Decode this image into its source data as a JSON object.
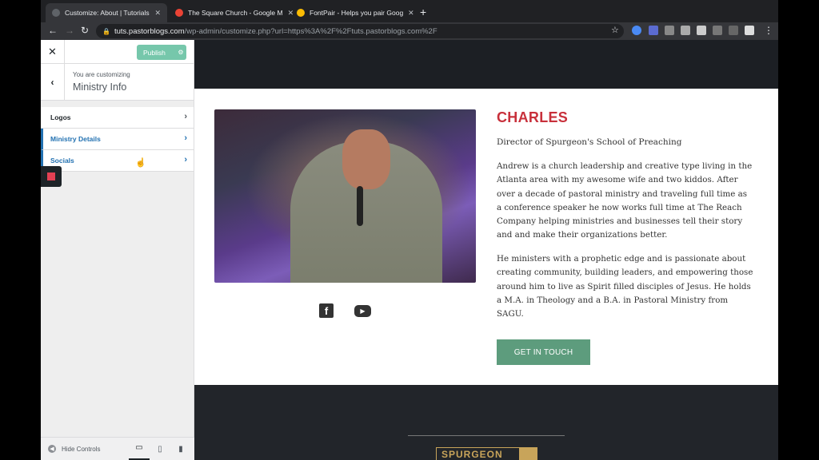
{
  "browser": {
    "tabs": [
      {
        "title": "Customize: About | Tutorials",
        "fav_color": "#5f6368",
        "active": true
      },
      {
        "title": "The Square Church - Google M",
        "fav_color": "#ea4335",
        "active": false
      },
      {
        "title": "FontPair - Helps you pair Goog",
        "fav_color": "#fbbc04",
        "active": false
      }
    ],
    "new_tab": "+",
    "url_host": "tuts.pastorblogs.com",
    "url_path": "/wp-admin/customize.php?url=https%3A%2F%2Ftuts.pastorblogs.com%2F"
  },
  "customizer": {
    "publish_label": "Publish",
    "customizing_label": "You are customizing",
    "section_title": "Ministry Info",
    "menu": [
      {
        "label": "Logos"
      },
      {
        "label": "Ministry Details"
      },
      {
        "label": "Socials"
      }
    ],
    "hide_controls": "Hide Controls"
  },
  "preview": {
    "name": "CHARLES",
    "role": "Director of Spurgeon's School of Preaching",
    "bio1": "Andrew is a church leadership and creative type living in the Atlanta area with my awesome wife and two kiddos. After over a decade of pastoral ministry and traveling full time as a conference speaker he now works full time at The Reach Company helping ministries and businesses tell their story and and make their organizations better.",
    "bio2": "He ministers with a prophetic edge and is passionate about creating community, building leaders, and empowering those around him to live as Spirit filled disciples of Jesus. He holds a M.A. in Theology and a B.A. in Pastoral Ministry from SAGU.",
    "cta_label": "GET IN TOUCH",
    "footer_logo": "SPURGEON",
    "accent_color": "#c8303b",
    "button_color": "#5d9c7d"
  }
}
